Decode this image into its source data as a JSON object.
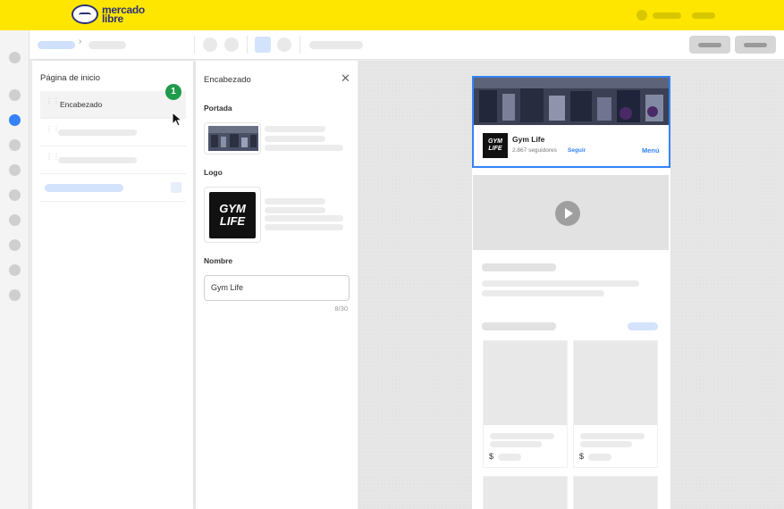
{
  "brand": {
    "name_line1": "mercado",
    "name_line2": "libre"
  },
  "pages_panel": {
    "title": "Página de inicio",
    "items": [
      {
        "label": "Encabezado"
      }
    ],
    "step_badge": "1"
  },
  "editor": {
    "title": "Encabezado",
    "close_icon": "close-icon",
    "cover_label": "Portada",
    "logo_label": "Logo",
    "logo_text_line1": "GYM",
    "logo_text_line2": "LIFE",
    "name_label": "Nombre",
    "name_value": "Gym Life",
    "name_counter": "8/30"
  },
  "preview": {
    "store_name": "Gym Life",
    "followers": "2.867 seguidores",
    "follow_label": "Seguir",
    "menu_label": "Menú",
    "logo_text_line1": "GYM",
    "logo_text_line2": "LIFE",
    "currency_symbol": "$",
    "accent_color": "#3483fa"
  },
  "colors": {
    "brand_yellow": "#ffe600",
    "accent_blue": "#3483fa",
    "badge_green": "#1f9b4b"
  }
}
